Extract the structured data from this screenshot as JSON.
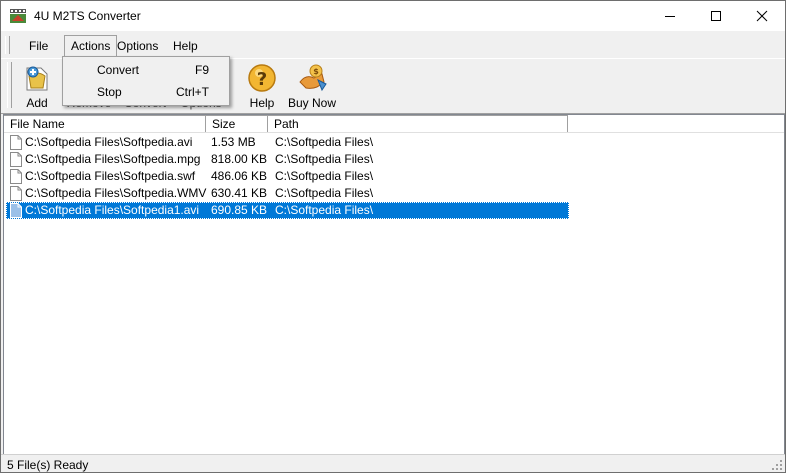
{
  "window": {
    "title": "4U M2TS Converter"
  },
  "menu": {
    "file": "File",
    "actions": "Actions",
    "options": "Options",
    "help": "Help"
  },
  "actions_menu": [
    {
      "label": "Convert",
      "shortcut": "F9"
    },
    {
      "label": "Stop",
      "shortcut": "Ctrl+T"
    }
  ],
  "toolbar": {
    "add": "Add",
    "hidden1": "Remove",
    "hidden2": "Convert",
    "hidden3": "Options",
    "help": "Help",
    "buy": "Buy Now"
  },
  "list": {
    "columns": [
      "File Name",
      "Size",
      "Path"
    ],
    "rows": [
      {
        "name": "C:\\Softpedia Files\\Softpedia.avi",
        "size": "1.53 MB",
        "path": "C:\\Softpedia Files\\"
      },
      {
        "name": "C:\\Softpedia Files\\Softpedia.mpg",
        "size": "818.00 KB",
        "path": "C:\\Softpedia Files\\"
      },
      {
        "name": "C:\\Softpedia Files\\Softpedia.swf",
        "size": "486.06 KB",
        "path": "C:\\Softpedia Files\\"
      },
      {
        "name": "C:\\Softpedia Files\\Softpedia.WMV",
        "size": "630.41 KB",
        "path": "C:\\Softpedia Files\\"
      },
      {
        "name": "C:\\Softpedia Files\\Softpedia1.avi",
        "size": "690.85 KB",
        "path": "C:\\Softpedia Files\\"
      }
    ]
  },
  "status": {
    "text": "5 File(s) Ready"
  },
  "colors": {
    "selection": "#0078d7",
    "window_bg": "#f0f0f0"
  },
  "icons": {
    "app": "film-app-icon",
    "add": "add-file-icon",
    "help": "help-icon",
    "buy": "buy-now-icon"
  }
}
